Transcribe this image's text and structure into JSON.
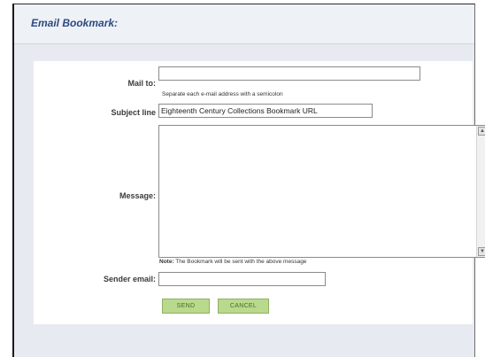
{
  "dialog": {
    "title": "Email Bookmark:"
  },
  "form": {
    "mail_to": {
      "label": "Mail to:",
      "value": "",
      "hint": "Separate each e-mail address with a semicolon"
    },
    "subject": {
      "label": "Subject line",
      "value": "Eighteenth Century Collections Bookmark URL"
    },
    "message": {
      "label": "Message:",
      "value": "",
      "note_prefix": "Note:",
      "note_text": " The Bookmark will be sent with the above message"
    },
    "sender_email": {
      "label": "Sender email:",
      "value": ""
    }
  },
  "buttons": {
    "send_label": "SEND",
    "cancel_label": "CANCEL"
  },
  "icons": {
    "scroll_up": "scroll-up-arrow-icon",
    "scroll_down": "scroll-down-arrow-icon"
  },
  "colors": {
    "title": "#2b4a80",
    "button_bg": "#b9d98c",
    "button_text": "#4a6a2a",
    "frame_bg": "#e7ebf1"
  }
}
